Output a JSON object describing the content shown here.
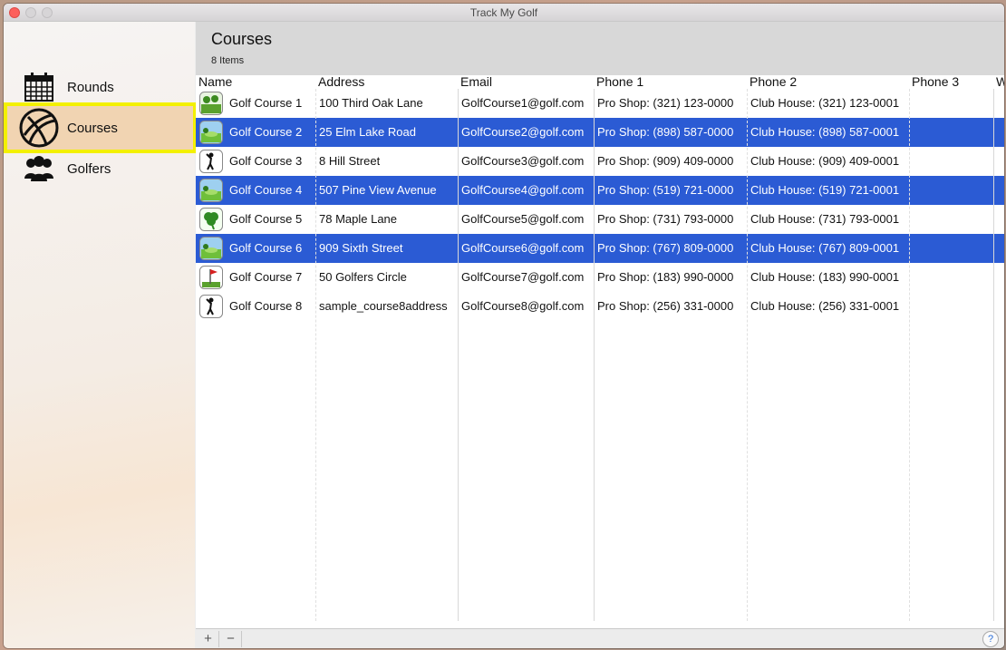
{
  "window": {
    "title": "Track My Golf"
  },
  "sidebar": {
    "items": [
      {
        "label": "Rounds",
        "icon": "calendar-icon"
      },
      {
        "label": "Courses",
        "icon": "globe-icon"
      },
      {
        "label": "Golfers",
        "icon": "group-icon"
      }
    ]
  },
  "header": {
    "title": "Courses",
    "count": "8 Items"
  },
  "table": {
    "columns": [
      "Name",
      "Address",
      "Email",
      "Phone 1",
      "Phone 2",
      "Phone 3",
      "W"
    ],
    "rows": [
      {
        "name": "Golf Course 1",
        "address": "100 Third Oak Lane",
        "email": "GolfCourse1@golf.com",
        "phone1": "Pro Shop: (321) 123-0000",
        "phone2": "Club House: (321) 123-0001",
        "selected": false,
        "thumb": "course-flag-icon"
      },
      {
        "name": "Golf Course 2",
        "address": "25 Elm Lake Road",
        "email": "GolfCourse2@golf.com",
        "phone1": "Pro Shop: (898) 587-0000",
        "phone2": "Club House: (898) 587-0001",
        "selected": true,
        "thumb": "course-landscape-icon"
      },
      {
        "name": "Golf Course 3",
        "address": "8 Hill Street",
        "email": "GolfCourse3@golf.com",
        "phone1": "Pro Shop: (909) 409-0000",
        "phone2": "Club House: (909) 409-0001",
        "selected": false,
        "thumb": "golfer-swing-icon"
      },
      {
        "name": "Golf Course 4",
        "address": "507 Pine View Avenue",
        "email": "GolfCourse4@golf.com",
        "phone1": "Pro Shop: (519) 721-0000",
        "phone2": "Club House: (519) 721-0001",
        "selected": true,
        "thumb": "course-landscape-icon"
      },
      {
        "name": "Golf Course 5",
        "address": "78 Maple Lane",
        "email": "GolfCourse5@golf.com",
        "phone1": "Pro Shop: (731) 793-0000",
        "phone2": "Club House: (731) 793-0001",
        "selected": false,
        "thumb": "clover-icon"
      },
      {
        "name": "Golf Course 6",
        "address": "909 Sixth Street",
        "email": "GolfCourse6@golf.com",
        "phone1": "Pro Shop: (767) 809-0000",
        "phone2": "Club House: (767) 809-0001",
        "selected": true,
        "thumb": "course-landscape-icon"
      },
      {
        "name": "Golf Course 7",
        "address": "50 Golfers Circle",
        "email": "GolfCourse7@golf.com",
        "phone1": "Pro Shop: (183) 990-0000",
        "phone2": "Club House: (183) 990-0001",
        "selected": false,
        "thumb": "hole-flag-icon"
      },
      {
        "name": "Golf Course 8",
        "address": "sample_course8address",
        "email": "GolfCourse8@golf.com",
        "phone1": "Pro Shop: (256) 331-0000",
        "phone2": "Club House: (256) 331-0001",
        "selected": false,
        "thumb": "golfer-swing-icon"
      }
    ]
  },
  "bottombar": {
    "add": "+",
    "remove": "−",
    "help": "?"
  },
  "colors": {
    "selection": "#2b5bd4",
    "highlight_outline": "#f3f000",
    "selected_sidebar": "#f1d4b2"
  }
}
